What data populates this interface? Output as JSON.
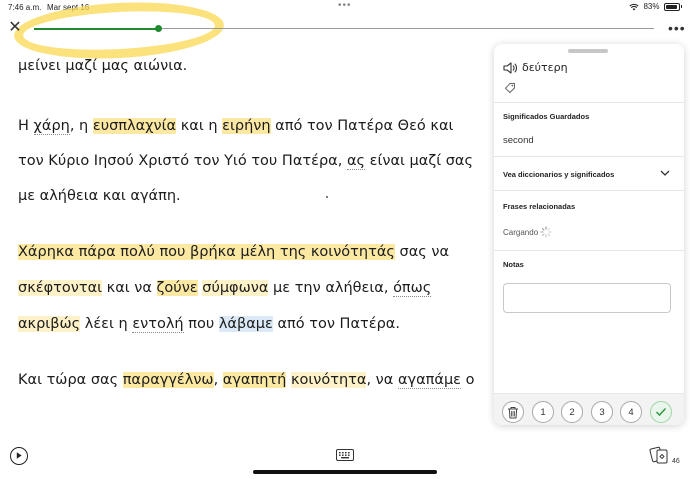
{
  "status": {
    "time": "7:46 a.m.",
    "date": "Mar sept 16",
    "battery": "83%",
    "wifi_icon": "wifi-icon"
  },
  "top_bar": {
    "close_glyph": "✕",
    "more_glyph": "•••",
    "progress": 0.2,
    "accent_color": "#1f8a2e"
  },
  "reading": {
    "lines": [
      [
        {
          "t": "μείνει μαζί μας αιώνια.",
          "c": ""
        }
      ],
      [
        {
          "t": "Η ",
          "c": ""
        },
        {
          "t": "χάρη",
          "c": "new"
        },
        {
          "t": ", η ",
          "c": ""
        },
        {
          "t": "ευσπλαχνία",
          "c": "lk"
        },
        {
          "t": " και η ",
          "c": ""
        },
        {
          "t": "ειρήνη",
          "c": "lk"
        },
        {
          "t": " από τον Πατέρα Θεό και",
          "c": ""
        }
      ],
      [
        {
          "t": "τον Κύριο Ιησού Χριστό τον Υιό του Πατέρα, ",
          "c": ""
        },
        {
          "t": "ας",
          "c": "new"
        },
        {
          "t": " είναι μαζί σας",
          "c": ""
        }
      ],
      [
        {
          "t": "με αλήθεια και αγάπη.",
          "c": ""
        }
      ],
      [
        {
          "t": "Χάρηκα πάρα πολύ που βρήκα μέλη της κοινότητάς",
          "c": "lk"
        },
        {
          "t": " σας να",
          "c": ""
        }
      ],
      [
        {
          "t": "σκέφτονται",
          "c": "lk2"
        },
        {
          "t": " και να ",
          "c": ""
        },
        {
          "t": "ζούνε",
          "c": "lk"
        },
        {
          "t": " ",
          "c": ""
        },
        {
          "t": "σύμφωνα",
          "c": "lk2"
        },
        {
          "t": " με την αλήθεια, ",
          "c": ""
        },
        {
          "t": "όπως",
          "c": "new"
        }
      ],
      [
        {
          "t": "ακριβώς",
          "c": "lk2"
        },
        {
          "t": " λέει η ",
          "c": ""
        },
        {
          "t": "εντολή",
          "c": "new"
        },
        {
          "t": " που ",
          "c": ""
        },
        {
          "t": "λάβαμε",
          "c": "lb"
        },
        {
          "t": " από τον Πατέρα.",
          "c": ""
        }
      ],
      [
        {
          "t": "Και τώρα σας ",
          "c": ""
        },
        {
          "t": "παραγγέλνω",
          "c": "lk"
        },
        {
          "t": ", ",
          "c": ""
        },
        {
          "t": "αγαπητή",
          "c": "lk"
        },
        {
          "t": " ",
          "c": ""
        },
        {
          "t": "κοινότητα",
          "c": "lk2"
        },
        {
          "t": ", να ",
          "c": ""
        },
        {
          "t": "αγαπάμε",
          "c": "new"
        },
        {
          "t": " ο",
          "c": ""
        }
      ]
    ]
  },
  "panel": {
    "term": "δεύτερη",
    "speaker_icon": "speaker-icon",
    "tag_icon": "tag-icon",
    "saved_meanings_label": "Significados Guardados",
    "saved_meaning": "second",
    "dictionaries_label": "Vea diccionarios y significados",
    "related_phrases_label": "Frases relacionadas",
    "loading_text": "Cargando",
    "notes_label": "Notas",
    "notes_value": "",
    "status_buttons": [
      "1",
      "2",
      "3",
      "4"
    ],
    "trash_icon": "trash-icon",
    "check_icon": "check-icon"
  },
  "bottom": {
    "play_icon": "play-icon",
    "keyboard_icon": "keyboard-icon",
    "cards_icon": "flashcards-icon",
    "cards_count": "46"
  }
}
